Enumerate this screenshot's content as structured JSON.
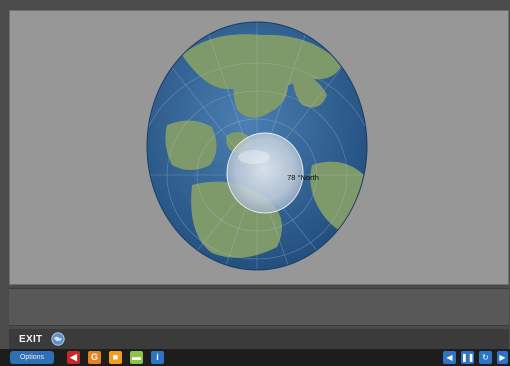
{
  "stage": {
    "lens_label": "78 °North"
  },
  "caption": {
    "text": ""
  },
  "controls": {
    "exit_label": "EXIT",
    "footer_text": ""
  },
  "toolbar": {
    "options_label": "Options",
    "icons": [
      {
        "name": "audio-icon",
        "color": "#c62828",
        "glyph": "◀"
      },
      {
        "name": "glossary-icon",
        "color": "#e8801f",
        "glyph": "G"
      },
      {
        "name": "notes-icon",
        "color": "#f29d1b",
        "glyph": "■"
      },
      {
        "name": "comment-icon",
        "color": "#8bc34a",
        "glyph": "▬"
      },
      {
        "name": "info-icon",
        "color": "#2d74c4",
        "glyph": "i"
      }
    ],
    "nav": [
      {
        "name": "previous-button",
        "glyph": "◀"
      },
      {
        "name": "pause-button",
        "glyph": "❚❚"
      },
      {
        "name": "replay-button",
        "glyph": "↻"
      },
      {
        "name": "next-button",
        "glyph": "▶"
      }
    ]
  },
  "colors": {
    "ocean": "#2f5e94",
    "land": "#7f9a6a",
    "stage_bg": "#979797",
    "accent_blue": "#2d74c4"
  }
}
